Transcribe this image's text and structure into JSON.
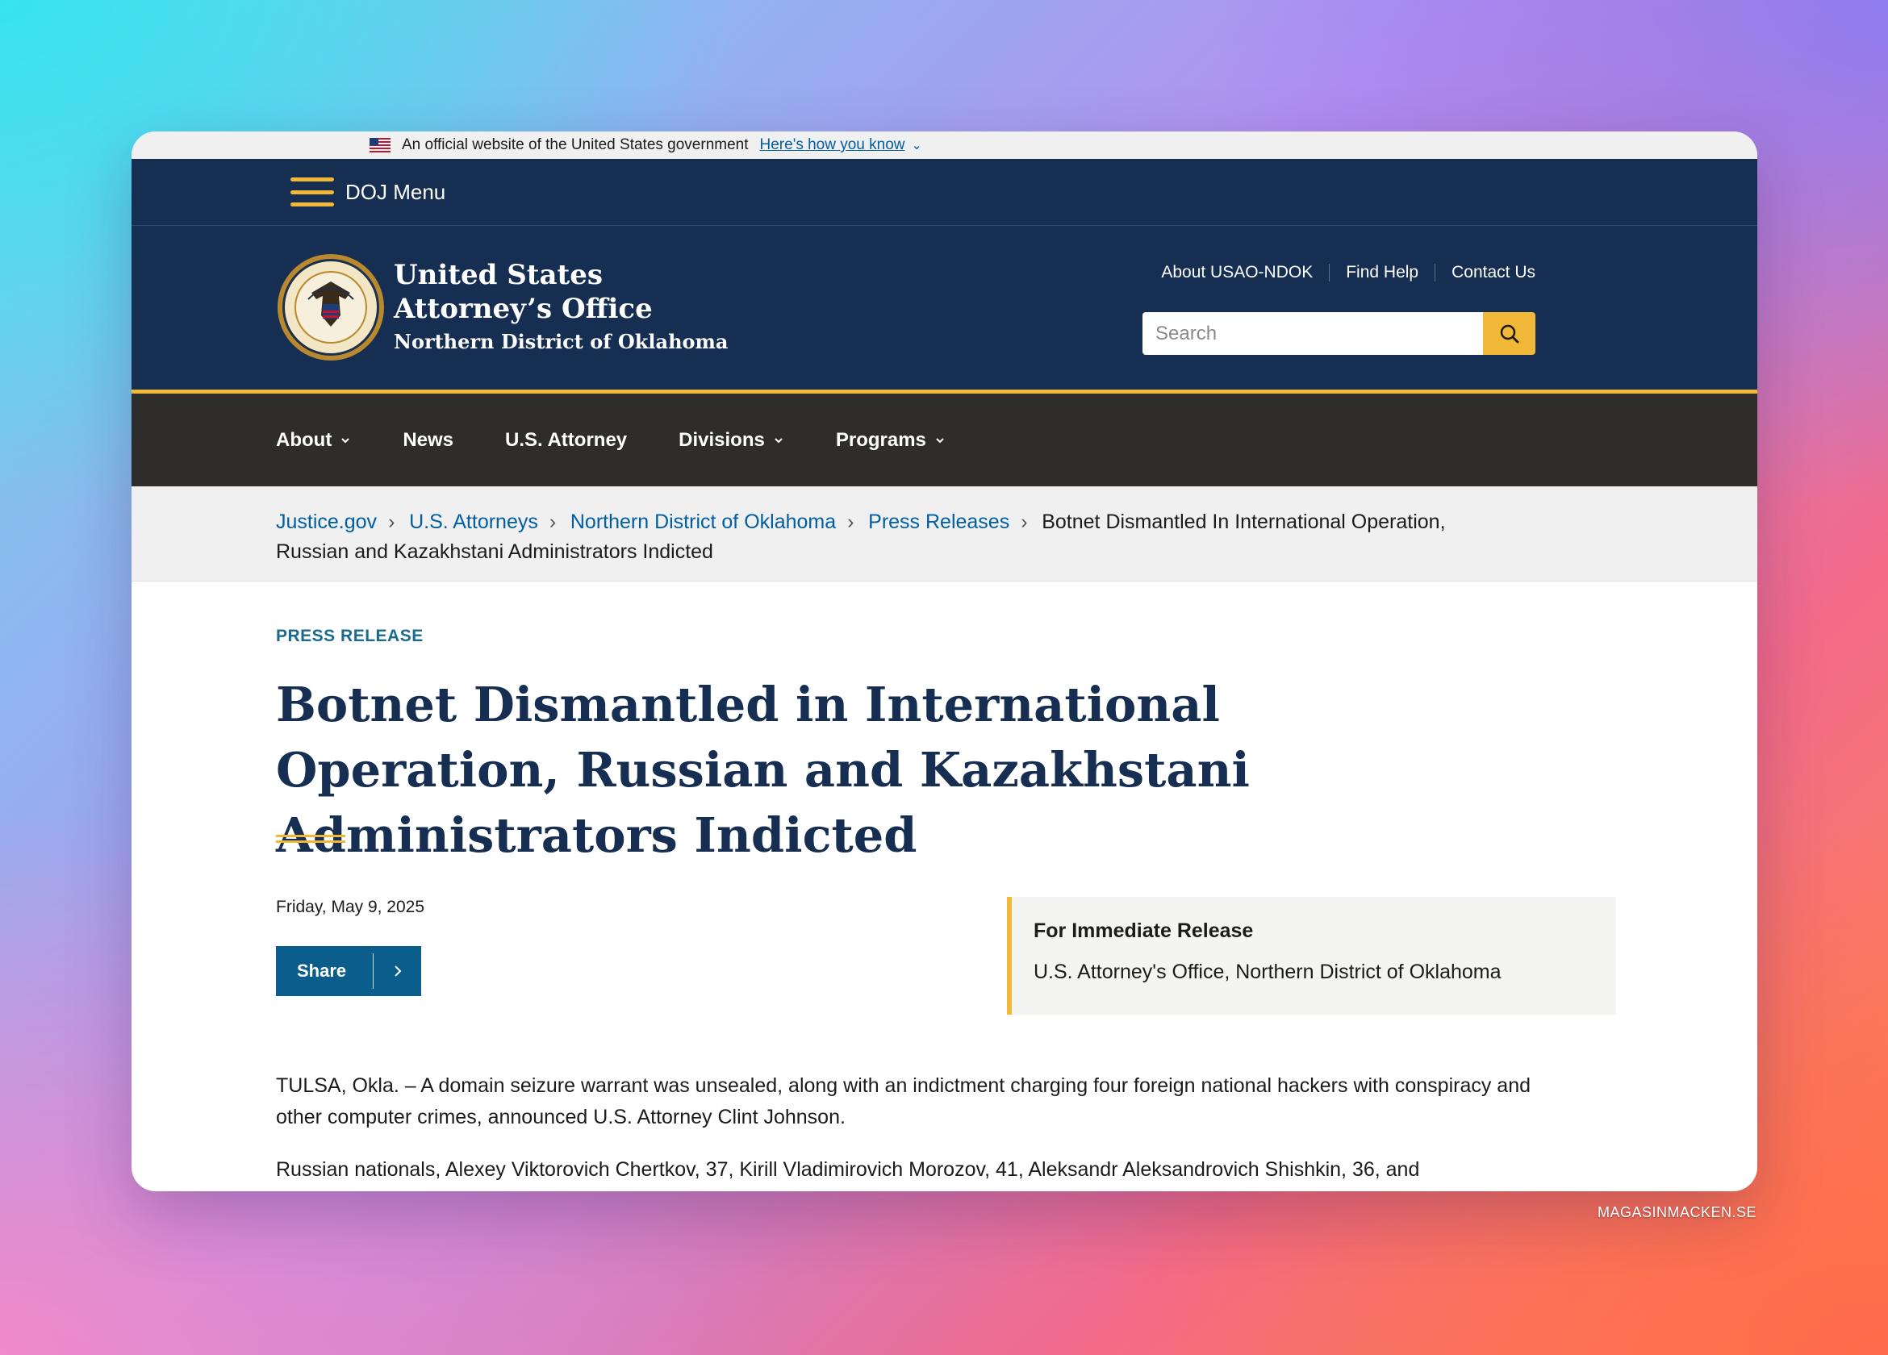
{
  "gov_banner": {
    "text": "An official website of the United States government",
    "link": "Here's how you know"
  },
  "doj_menu": {
    "label": "DOJ Menu"
  },
  "header": {
    "title_line1": "United States",
    "title_line2": "Attorney’s Office",
    "subtitle": "Northern District of Oklahoma",
    "links": [
      "About USAO-NDOK",
      "Find Help",
      "Contact Us"
    ],
    "search_placeholder": "Search"
  },
  "nav": {
    "items": [
      {
        "label": "About",
        "dropdown": true
      },
      {
        "label": "News",
        "dropdown": false
      },
      {
        "label": "U.S. Attorney",
        "dropdown": false
      },
      {
        "label": "Divisions",
        "dropdown": true
      },
      {
        "label": "Programs",
        "dropdown": true
      }
    ]
  },
  "breadcrumb": {
    "items": [
      "Justice.gov",
      "U.S. Attorneys",
      "Northern District of Oklahoma",
      "Press Releases"
    ],
    "current": "Botnet Dismantled In International Operation, Russian and Kazakhstani Administrators Indicted"
  },
  "article": {
    "eyebrow": "PRESS RELEASE",
    "title": "Botnet Dismantled in International Operation, Russian and Kazakhstani Administrators Indicted",
    "date": "Friday, May 9, 2025",
    "share_label": "Share",
    "release_box": {
      "title": "For Immediate Release",
      "office": "U.S. Attorney's Office, Northern District of Oklahoma"
    },
    "paragraphs": [
      "TULSA, Okla. – A domain seizure warrant was unsealed, along with an indictment charging four foreign national hackers with conspiracy and other computer crimes, announced U.S. Attorney Clint Johnson.",
      "Russian nationals, Alexey Viktorovich Chertkov, 37, Kirill Vladimirovich Morozov, 41, Aleksandr Aleksandrovich Shishkin, 36, and"
    ]
  },
  "watermark": "MAGASINMACKEN.SE",
  "colors": {
    "navy": "#162e51",
    "gold": "#f1b737",
    "nav_dark": "#2e2d2b",
    "link_blue": "#005ea2",
    "share_blue": "#0b5e8b"
  }
}
